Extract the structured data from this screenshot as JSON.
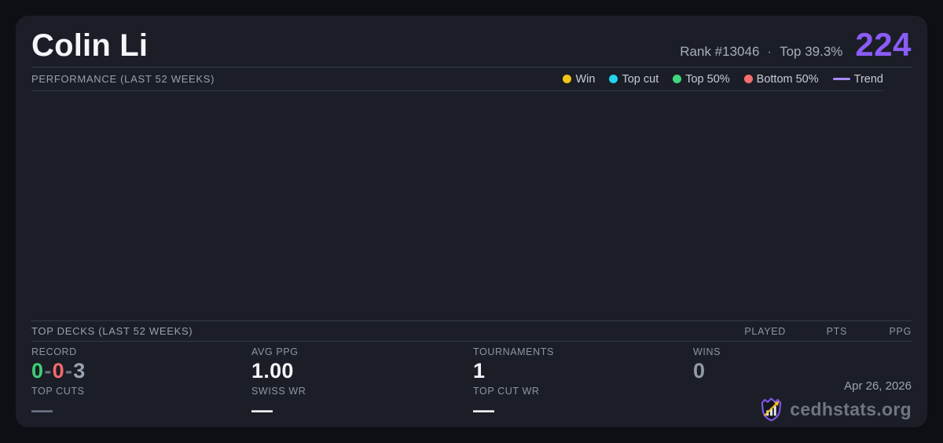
{
  "colors": {
    "page_background": "#0d0f14",
    "card_background": "#1b1e27",
    "accent": "#8b5cf6",
    "record_win": "#3ecf76",
    "record_loss": "#f56a6a",
    "record_draw": "#9aa3b0"
  },
  "header": {
    "player_name": "Colin Li",
    "rank": "Rank #13046",
    "separator": "·",
    "top_percent": "Top 39.3%",
    "score": "224"
  },
  "performance": {
    "title": "PERFORMANCE (LAST 52 WEEKS)",
    "legend": [
      {
        "label": "Win",
        "color": "#f0c419",
        "swatch": "dot"
      },
      {
        "label": "Top cut",
        "color": "#24d3ee",
        "swatch": "dot"
      },
      {
        "label": "Top 50%",
        "color": "#3fd77d",
        "swatch": "dot"
      },
      {
        "label": "Bottom 50%",
        "color": "#f56d6d",
        "swatch": "dot"
      },
      {
        "label": "Trend",
        "color": "#a78bfa",
        "swatch": "line"
      }
    ],
    "points": []
  },
  "top_decks": {
    "title": "TOP DECKS (LAST 52 WEEKS)",
    "columns": [
      "PLAYED",
      "PTS",
      "PPG"
    ],
    "rows": []
  },
  "stats": {
    "record": {
      "label": "RECORD",
      "wins": "0",
      "losses": "0",
      "draws": "3",
      "sep": "-"
    },
    "avg_ppg": {
      "label": "AVG PPG",
      "value": "1.00"
    },
    "tournaments": {
      "label": "TOURNAMENTS",
      "value": "1"
    },
    "wins": {
      "label": "WINS",
      "value": "0"
    },
    "top_cuts": {
      "label": "TOP CUTS",
      "value": "—"
    },
    "swiss_wr": {
      "label": "SWISS WR",
      "value": "—"
    },
    "top_cut_wr": {
      "label": "TOP CUT WR",
      "value": "—"
    }
  },
  "footer": {
    "date": "Apr 26, 2026",
    "brand": "cedhstats.org",
    "logo": "cedhstats-shield-logo"
  }
}
